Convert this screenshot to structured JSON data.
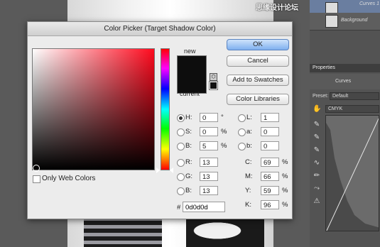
{
  "dialog": {
    "title": "Color Picker (Target Shadow Color)",
    "new_label": "new",
    "current_label": "current",
    "new_color": "#0d0d0d",
    "current_color": "#0d0d0d",
    "only_web_colors": "Only Web Colors",
    "buttons": {
      "ok": "OK",
      "cancel": "Cancel",
      "add_to_swatches": "Add to Swatches",
      "color_libraries": "Color Libraries"
    },
    "hsb": [
      {
        "label": "H:",
        "value": "0",
        "unit": "°",
        "selected": true
      },
      {
        "label": "S:",
        "value": "0",
        "unit": "%",
        "selected": false
      },
      {
        "label": "B:",
        "value": "5",
        "unit": "%",
        "selected": false
      }
    ],
    "rgb": [
      {
        "label": "R:",
        "value": "13"
      },
      {
        "label": "G:",
        "value": "13"
      },
      {
        "label": "B:",
        "value": "13"
      }
    ],
    "lab": [
      {
        "label": "L:",
        "value": "1"
      },
      {
        "label": "a:",
        "value": "0"
      },
      {
        "label": "b:",
        "value": "0"
      }
    ],
    "cmyk": [
      {
        "label": "C:",
        "value": "69",
        "unit": "%"
      },
      {
        "label": "M:",
        "value": "66",
        "unit": "%"
      },
      {
        "label": "Y:",
        "value": "59",
        "unit": "%"
      },
      {
        "label": "K:",
        "value": "96",
        "unit": "%"
      }
    ],
    "hex_label": "#",
    "hex_value": "0d0d0d"
  },
  "panel": {
    "layers": [
      "Curves 1",
      "Background"
    ],
    "watermark": "思缘设计论坛",
    "properties_tab": "Properties",
    "adjustment": "Curves",
    "preset_label": "Preset:",
    "preset_value": "Default",
    "channel_value": "CMYK"
  }
}
